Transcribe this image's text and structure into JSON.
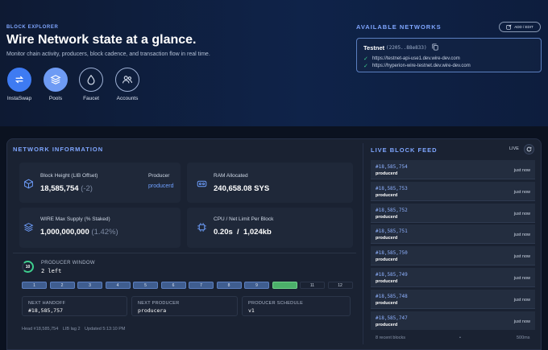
{
  "hero": {
    "tag": "BLOCK EXPLORER",
    "title": "Wire Network state at a glance.",
    "subtitle": "Monitor chain activity, producers, block cadence, and transaction flow in real time.",
    "actions": [
      {
        "label": "InstaSwap",
        "icon": "swap-icon",
        "active": true
      },
      {
        "label": "Pools",
        "icon": "layers-icon",
        "active": false
      },
      {
        "label": "Faucet",
        "icon": "droplet-icon",
        "active": false
      },
      {
        "label": "Accounts",
        "icon": "users-icon",
        "active": false
      }
    ]
  },
  "networks": {
    "title": "AVAILABLE NETWORKS",
    "add_edit": "ADD / EDIT",
    "card": {
      "name": "Testnet",
      "hash": "(2205..88e833)",
      "endpoints": [
        "https://testnet-api-use1.dev.wire-dev.com",
        "https://hyperion-wire-testnet.dev.wire-dev.com"
      ]
    }
  },
  "network_info": {
    "title": "NETWORK INFORMATION",
    "block_height": {
      "label": "Block Height (LIB Offset)",
      "value": "18,585,754",
      "offset": "(-2)"
    },
    "producer": {
      "label": "Producer",
      "value": "producerd"
    },
    "ram": {
      "label": "RAM Allocated",
      "value": "240,658.08 SYS"
    },
    "supply": {
      "label": "WIRE Max Supply (% Staked)",
      "value": "1,000,000,000",
      "staked": "(1.42%)"
    },
    "cpu_net": {
      "label": "CPU / Net Limit Per Block",
      "value": "0.20s  /  1,024kb"
    },
    "producer_window": {
      "ring_value": "10",
      "title": "PRODUCER WINDOW",
      "left": "2 left",
      "slots": [
        {
          "label": "1",
          "state": "done"
        },
        {
          "label": "2",
          "state": "done"
        },
        {
          "label": "3",
          "state": "done"
        },
        {
          "label": "4",
          "state": "done"
        },
        {
          "label": "5",
          "state": "done"
        },
        {
          "label": "6",
          "state": "done"
        },
        {
          "label": "7",
          "state": "done"
        },
        {
          "label": "8",
          "state": "done"
        },
        {
          "label": "9",
          "state": "done"
        },
        {
          "label": "10",
          "state": "current"
        },
        {
          "label": "11",
          "state": "future"
        },
        {
          "label": "12",
          "state": "future"
        }
      ]
    },
    "next_handoff": {
      "label": "NEXT HANDOFF",
      "value": "#18,585,757"
    },
    "next_producer": {
      "label": "NEXT PRODUCER",
      "value": "producera"
    },
    "schedule": {
      "label": "PRODUCER SCHEDULE",
      "value": "v1"
    },
    "footer": {
      "head": "Head #18,585,754",
      "lib_lag": "LIB lag 2",
      "updated": "Updated 5:13:10 PM"
    }
  },
  "feed": {
    "title": "LIVE BLOCK FEED",
    "live": "LIVE",
    "rows": [
      {
        "block": "#18,585,754",
        "producer": "producerd",
        "time": "just now"
      },
      {
        "block": "#18,585,753",
        "producer": "producerd",
        "time": "just now"
      },
      {
        "block": "#18,585,752",
        "producer": "producerd",
        "time": "just now"
      },
      {
        "block": "#18,585,751",
        "producer": "producerd",
        "time": "just now"
      },
      {
        "block": "#18,585,750",
        "producer": "producerd",
        "time": "just now"
      },
      {
        "block": "#18,585,749",
        "producer": "producerd",
        "time": "just now"
      },
      {
        "block": "#18,585,748",
        "producer": "producerd",
        "time": "just now"
      },
      {
        "block": "#18,585,747",
        "producer": "producerd",
        "time": "just now"
      }
    ],
    "footer_count": "8 recent blocks",
    "footer_sep": "•",
    "footer_interval": "500ms"
  }
}
